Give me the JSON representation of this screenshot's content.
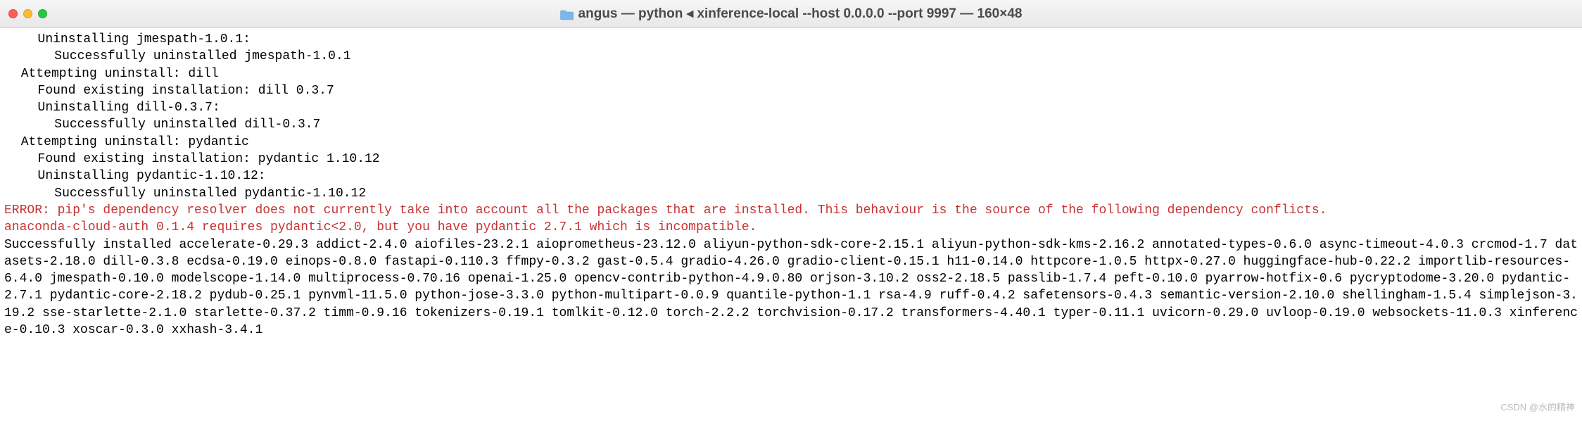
{
  "titlebar": {
    "title": "angus — python ◂ xinference-local --host 0.0.0.0 --port 9997 — 160×48"
  },
  "terminal": {
    "lines": [
      {
        "text": "Uninstalling jmespath-1.0.1:",
        "indent": 2,
        "class": ""
      },
      {
        "text": "Successfully uninstalled jmespath-1.0.1",
        "indent": 3,
        "class": ""
      },
      {
        "text": "Attempting uninstall: dill",
        "indent": 1,
        "class": ""
      },
      {
        "text": "Found existing installation: dill 0.3.7",
        "indent": 2,
        "class": ""
      },
      {
        "text": "Uninstalling dill-0.3.7:",
        "indent": 2,
        "class": ""
      },
      {
        "text": "Successfully uninstalled dill-0.3.7",
        "indent": 3,
        "class": ""
      },
      {
        "text": "Attempting uninstall: pydantic",
        "indent": 1,
        "class": ""
      },
      {
        "text": "Found existing installation: pydantic 1.10.12",
        "indent": 2,
        "class": ""
      },
      {
        "text": "Uninstalling pydantic-1.10.12:",
        "indent": 2,
        "class": ""
      },
      {
        "text": "Successfully uninstalled pydantic-1.10.12",
        "indent": 3,
        "class": ""
      },
      {
        "text": "ERROR: pip's dependency resolver does not currently take into account all the packages that are installed. This behaviour is the source of the following dependency conflicts.",
        "indent": 0,
        "class": "error-red"
      },
      {
        "text": "anaconda-cloud-auth 0.1.4 requires pydantic<2.0, but you have pydantic 2.7.1 which is incompatible.",
        "indent": 0,
        "class": "error-red"
      },
      {
        "text": "Successfully installed accelerate-0.29.3 addict-2.4.0 aiofiles-23.2.1 aioprometheus-23.12.0 aliyun-python-sdk-core-2.15.1 aliyun-python-sdk-kms-2.16.2 annotated-types-0.6.0 async-timeout-4.0.3 crcmod-1.7 datasets-2.18.0 dill-0.3.8 ecdsa-0.19.0 einops-0.8.0 fastapi-0.110.3 ffmpy-0.3.2 gast-0.5.4 gradio-4.26.0 gradio-client-0.15.1 h11-0.14.0 httpcore-1.0.5 httpx-0.27.0 huggingface-hub-0.22.2 importlib-resources-6.4.0 jmespath-0.10.0 modelscope-1.14.0 multiprocess-0.70.16 openai-1.25.0 opencv-contrib-python-4.9.0.80 orjson-3.10.2 oss2-2.18.5 passlib-1.7.4 peft-0.10.0 pyarrow-hotfix-0.6 pycryptodome-3.20.0 pydantic-2.7.1 pydantic-core-2.18.2 pydub-0.25.1 pynvml-11.5.0 python-jose-3.3.0 python-multipart-0.0.9 quantile-python-1.1 rsa-4.9 ruff-0.4.2 safetensors-0.4.3 semantic-version-2.10.0 shellingham-1.5.4 simplejson-3.19.2 sse-starlette-2.1.0 starlette-0.37.2 timm-0.9.16 tokenizers-0.19.1 tomlkit-0.12.0 torch-2.2.2 torchvision-0.17.2 transformers-4.40.1 typer-0.11.1 uvicorn-0.29.0 uvloop-0.19.0 websockets-11.0.3 xinference-0.10.3 xoscar-0.3.0 xxhash-3.4.1",
        "indent": 0,
        "class": ""
      }
    ]
  },
  "watermark": "CSDN @水的精神"
}
